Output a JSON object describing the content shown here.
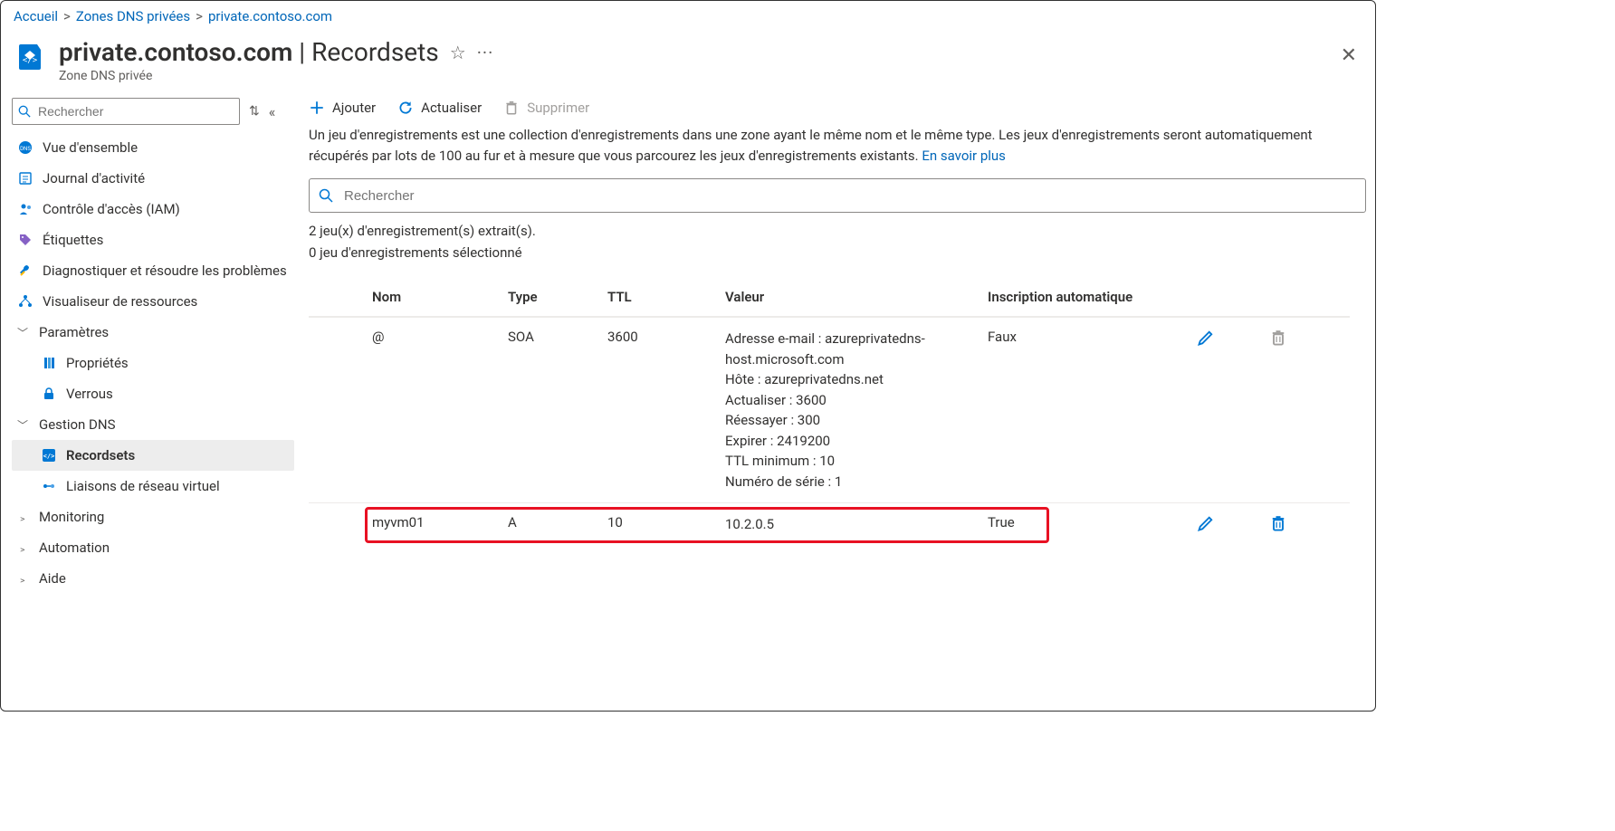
{
  "breadcrumb": {
    "items": [
      {
        "label": "Accueil"
      },
      {
        "label": "Zones DNS privées"
      },
      {
        "label": "private.contoso.com"
      }
    ],
    "separator": ">"
  },
  "header": {
    "title_main": "private.contoso.com",
    "title_separator": " | ",
    "title_sub": "Recordsets",
    "subtitle": "Zone DNS privée",
    "star_glyph": "☆",
    "dots_glyph": "···"
  },
  "close_x": "✕",
  "sidebar": {
    "search_placeholder": "Rechercher",
    "updown_glyph": "⇅",
    "collapse_glyph": "«",
    "items": [
      {
        "label": "Vue d'ensemble",
        "icon": "dns"
      },
      {
        "label": "Journal d'activité",
        "icon": "log"
      },
      {
        "label": "Contrôle d'accès (IAM)",
        "icon": "iam"
      },
      {
        "label": "Étiquettes",
        "icon": "tag"
      },
      {
        "label": "Diagnostiquer et résoudre les problèmes",
        "icon": "diag"
      },
      {
        "label": "Visualiseur de ressources",
        "icon": "viz"
      }
    ],
    "groups": [
      {
        "label": "Paramètres",
        "items": [
          {
            "label": "Propriétés",
            "icon": "props"
          },
          {
            "label": "Verrous",
            "icon": "lock"
          }
        ]
      },
      {
        "label": "Gestion DNS",
        "items": [
          {
            "label": "Recordsets",
            "icon": "recordsets",
            "selected": true
          },
          {
            "label": "Liaisons de réseau virtuel",
            "icon": "vnet"
          }
        ]
      },
      {
        "label": "Monitoring",
        "collapsed": true
      },
      {
        "label": "Automation",
        "collapsed": true
      },
      {
        "label": "Aide",
        "collapsed": true
      }
    ]
  },
  "toolbar": {
    "add_label": "Ajouter",
    "refresh_label": "Actualiser",
    "delete_label": "Supprimer"
  },
  "description": {
    "text": "Un jeu d'enregistrements est une collection d'enregistrements dans une zone ayant le même nom et le même type. Les jeux d'enregistrements seront automatiquement récupérés par lots de 100 au fur et à mesure que vous parcourez les jeux d'enregistrements existants. ",
    "link": "En savoir plus"
  },
  "main_search_placeholder": "Rechercher",
  "counts": {
    "line1": "2 jeu(x) d'enregistrement(s) extrait(s).",
    "line2": "0 jeu d'enregistrements sélectionné"
  },
  "table": {
    "headers": {
      "name": "Nom",
      "type": "Type",
      "ttl": "TTL",
      "value": "Valeur",
      "auto": "Inscription automatique"
    },
    "rows": [
      {
        "name": "@",
        "type": "SOA",
        "ttl": "3600",
        "value": "Adresse e-mail : azureprivatedns-host.microsoft.com\nHôte : azureprivatedns.net\nActualiser : 3600\nRéessayer : 300\nExpirer : 2419200\nTTL minimum : 10\nNuméro de série : 1",
        "auto": "Faux",
        "can_delete": false,
        "highlight": false
      },
      {
        "name": "myvm01",
        "type": "A",
        "ttl": "10",
        "value": "10.2.0.5",
        "auto": "True",
        "can_delete": true,
        "highlight": true
      }
    ]
  }
}
